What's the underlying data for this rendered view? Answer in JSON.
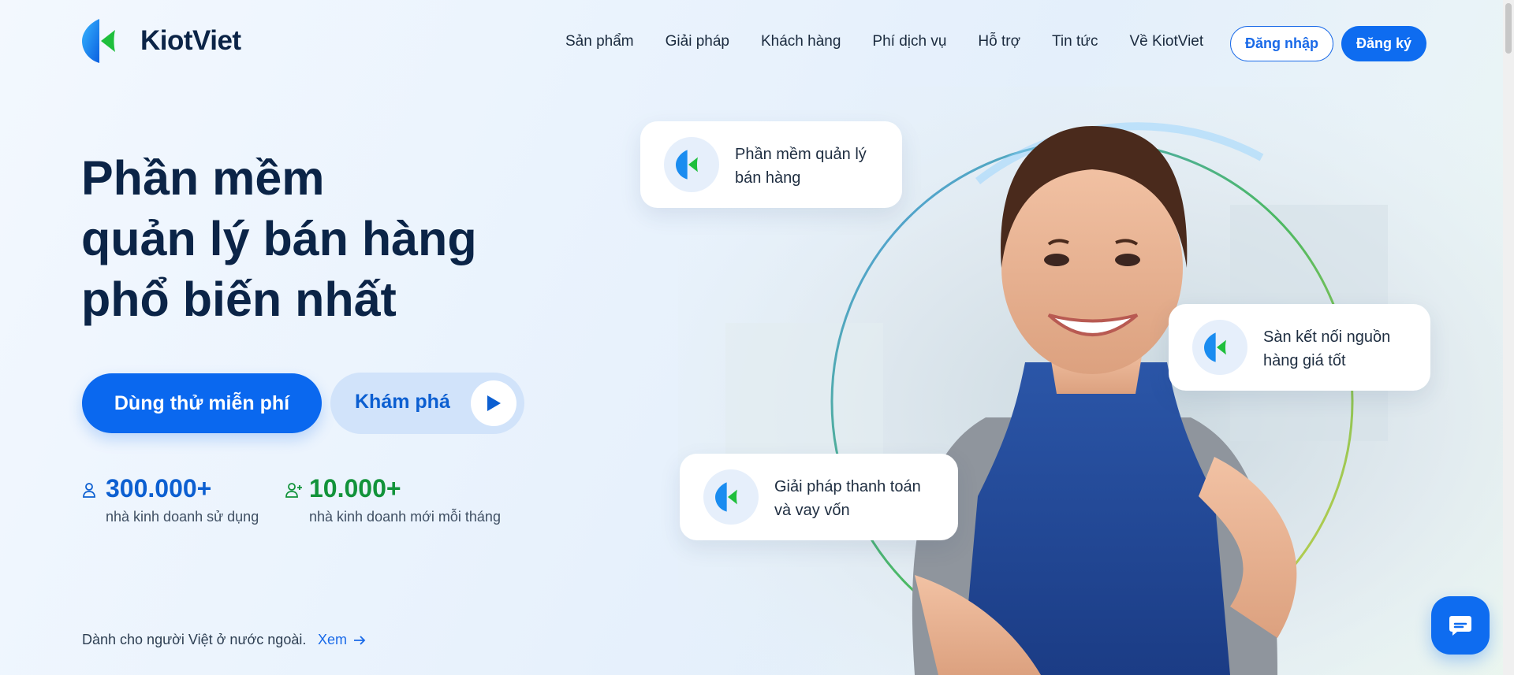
{
  "header": {
    "brand": "KiotViet",
    "nav": [
      "Sản phẩm",
      "Giải pháp",
      "Khách hàng",
      "Phí dịch vụ",
      "Hỗ trợ",
      "Tin tức",
      "Về KiotViet"
    ],
    "login_label": "Đăng nhập",
    "signup_label": "Đăng ký"
  },
  "hero": {
    "title_lines": [
      "Phần mềm",
      "quản lý bán hàng",
      "phổ biến nhất"
    ],
    "trial_label": "Dùng thử miễn phí",
    "explore_label": "Khám phá",
    "stats": [
      {
        "value": "300.000+",
        "label": "nhà kinh doanh sử dụng",
        "color": "#0c5fd1"
      },
      {
        "value": "10.000+",
        "label": "nhà kinh doanh mới mỗi tháng",
        "color": "#12933a"
      }
    ],
    "footnote": "Dành cho người Việt ở nước ngoài.",
    "see_label": "Xem"
  },
  "feature_cards": [
    {
      "lines": [
        "Phần mềm quản lý",
        "bán hàng"
      ]
    },
    {
      "lines": [
        "Sàn kết nối nguồn",
        "hàng giá tốt"
      ]
    },
    {
      "lines": [
        "Giải pháp thanh toán",
        "và vay vốn"
      ]
    }
  ],
  "colors": {
    "primary": "#0e6cf0",
    "navy": "#0b2447",
    "green": "#12933a",
    "logo_blue": "#1a8cf0",
    "logo_green": "#1fbf3c"
  },
  "icons": [
    "kiotviet-logo-icon",
    "play-icon",
    "user-icon",
    "user-plus-icon",
    "arrow-right-icon",
    "chat-icon"
  ]
}
